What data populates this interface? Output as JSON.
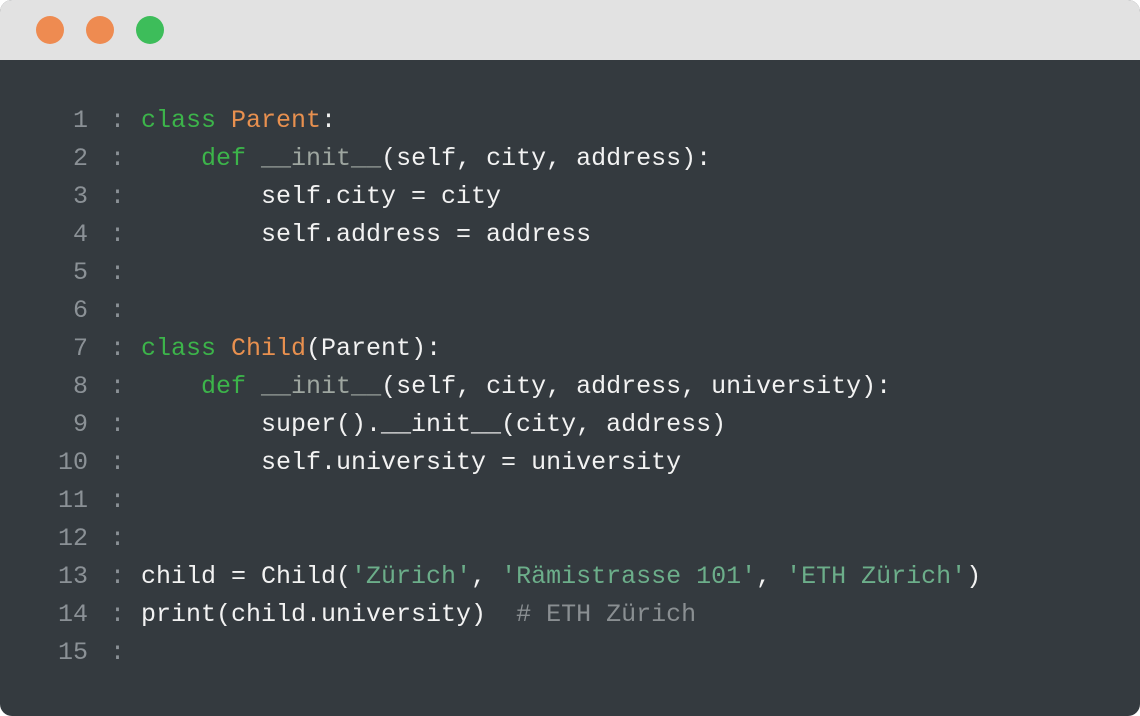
{
  "window": {
    "controls": [
      {
        "name": "close",
        "color": "#ee8b51"
      },
      {
        "name": "minimize",
        "color": "#ee8b51"
      },
      {
        "name": "maximize",
        "color": "#3dbd5a"
      }
    ]
  },
  "colors": {
    "background": "#343a3f",
    "titlebar": "#e2e2e2",
    "keyword": "#3cb44a",
    "classname": "#e8904f",
    "string": "#6cae8a",
    "comment": "#8a8f92",
    "line_number": "#8b9196",
    "text": "#f2f2f2"
  },
  "code": {
    "separator": ":",
    "lines": [
      {
        "number": "1",
        "tokens": [
          {
            "t": "class",
            "k": "keyword"
          },
          {
            "t": " ",
            "k": "plain"
          },
          {
            "t": "Parent",
            "k": "classname"
          },
          {
            "t": ":",
            "k": "plain"
          }
        ]
      },
      {
        "number": "2",
        "tokens": [
          {
            "t": "    ",
            "k": "plain"
          },
          {
            "t": "def",
            "k": "keyword"
          },
          {
            "t": " ",
            "k": "plain"
          },
          {
            "t": "__init__",
            "k": "dunder"
          },
          {
            "t": "(self, city, address):",
            "k": "plain"
          }
        ]
      },
      {
        "number": "3",
        "tokens": [
          {
            "t": "        self.city = city",
            "k": "plain"
          }
        ]
      },
      {
        "number": "4",
        "tokens": [
          {
            "t": "        self.address = address",
            "k": "plain"
          }
        ]
      },
      {
        "number": "5",
        "tokens": []
      },
      {
        "number": "6",
        "tokens": []
      },
      {
        "number": "7",
        "tokens": [
          {
            "t": "class",
            "k": "keyword"
          },
          {
            "t": " ",
            "k": "plain"
          },
          {
            "t": "Child",
            "k": "classname"
          },
          {
            "t": "(Parent):",
            "k": "plain"
          }
        ]
      },
      {
        "number": "8",
        "tokens": [
          {
            "t": "    ",
            "k": "plain"
          },
          {
            "t": "def",
            "k": "keyword"
          },
          {
            "t": " ",
            "k": "plain"
          },
          {
            "t": "__init__",
            "k": "dunder"
          },
          {
            "t": "(self, city, address, university):",
            "k": "plain"
          }
        ]
      },
      {
        "number": "9",
        "tokens": [
          {
            "t": "        super().__init__(city, address)",
            "k": "plain"
          }
        ]
      },
      {
        "number": "10",
        "tokens": [
          {
            "t": "        self.university = university",
            "k": "plain"
          }
        ]
      },
      {
        "number": "11",
        "tokens": []
      },
      {
        "number": "12",
        "tokens": []
      },
      {
        "number": "13",
        "tokens": [
          {
            "t": "child = Child(",
            "k": "plain"
          },
          {
            "t": "'Zürich'",
            "k": "string"
          },
          {
            "t": ", ",
            "k": "plain"
          },
          {
            "t": "'Rämistrasse 101'",
            "k": "string"
          },
          {
            "t": ", ",
            "k": "plain"
          },
          {
            "t": "'ETH Zürich'",
            "k": "string"
          },
          {
            "t": ")",
            "k": "plain"
          }
        ]
      },
      {
        "number": "14",
        "tokens": [
          {
            "t": "print(child.university)  ",
            "k": "plain"
          },
          {
            "t": "# ETH Zürich",
            "k": "comment"
          }
        ]
      },
      {
        "number": "15",
        "tokens": []
      }
    ]
  }
}
